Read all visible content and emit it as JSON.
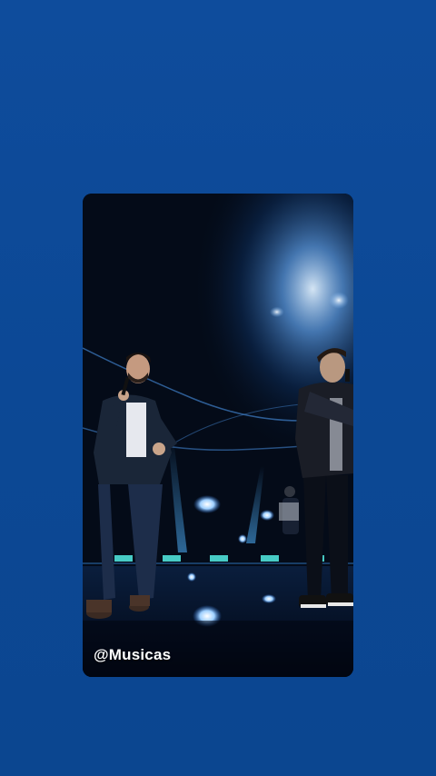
{
  "background_color": "#0d4a9a",
  "story": {
    "media_kind": "concert-video-frame",
    "handle": "@Musicas"
  }
}
